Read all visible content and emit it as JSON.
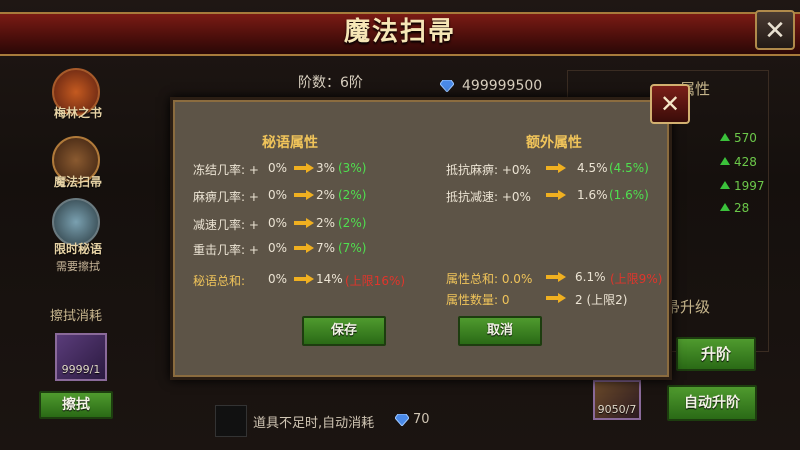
{
  "window": {
    "title": "魔法扫帚",
    "close_icon": "close-icon"
  },
  "sidebar": {
    "items": [
      {
        "label": "梅林之书",
        "icon": "book-icon"
      },
      {
        "label": "魔法扫帚",
        "icon": "broom-icon"
      },
      {
        "label": "限时秘语",
        "icon": "wand-icon",
        "sub": "需要擦拭"
      }
    ],
    "consume_label": "擦拭消耗",
    "slot_count": "9999/1",
    "wipe_button": "擦拭"
  },
  "header": {
    "rank": "阶数：6阶",
    "gems": "499999500"
  },
  "right_panel": {
    "title_fragment": "属性",
    "stats": [
      "570",
      "428",
      "1997",
      "28"
    ],
    "upgrade_title": "帚升级",
    "upgrade_button": "升阶",
    "auto_button": "自动升阶",
    "item_count": "9050/7"
  },
  "footer": {
    "auto_text": "道具不足时,自动消耗",
    "auto_cost": "70"
  },
  "dialog": {
    "left_title": "秘语属性",
    "right_title": "额外属性",
    "left_rows": [
      {
        "label": "冻结几率: +",
        "cur": "0%",
        "new": "3%",
        "diff": "(3%)"
      },
      {
        "label": "麻痹几率: +",
        "cur": "0%",
        "new": "2%",
        "diff": "(2%)"
      },
      {
        "label": "减速几率: +",
        "cur": "0%",
        "new": "2%",
        "diff": "(2%)"
      },
      {
        "label": "重击几率: +",
        "cur": "0%",
        "new": "7%",
        "diff": "(7%)"
      }
    ],
    "left_total": {
      "label": "秘语总和:",
      "cur": "0%",
      "new": "14%",
      "limit": "(上限16%)"
    },
    "right_rows": [
      {
        "label": "抵抗麻痹: +0%",
        "new": "4.5%",
        "diff": "(4.5%)"
      },
      {
        "label": "抵抗减速: +0%",
        "new": "1.6%",
        "diff": "(1.6%)"
      }
    ],
    "right_total": {
      "label": "属性总和: 0.0%",
      "new": "6.1%",
      "limit": "(上限9%)"
    },
    "right_count": {
      "label": "属性数量: 0",
      "new": "2 (上限2)"
    },
    "save_button": "保存",
    "cancel_button": "取消"
  },
  "colors": {
    "title_red": "#7a1b14",
    "gold": "#f0c45a",
    "green_text": "#4fe04f",
    "red_text": "#e0352b",
    "dialog_bg": "#5d5447",
    "button_green": "#4f9a2e"
  }
}
